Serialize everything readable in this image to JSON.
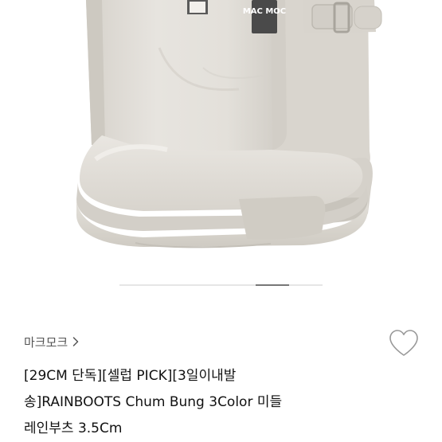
{
  "product": {
    "image": {
      "label_text": "MAC MOC",
      "background": "#ffffff",
      "boot_color": "#e2dfd9",
      "sole_color": "#ddd9d2"
    },
    "carousel": {
      "current": 4,
      "total": 6
    },
    "brand": {
      "name": "마크모크",
      "chevron_icon": "chevron-right-icon"
    },
    "wishlist": {
      "icon": "heart-outline-icon"
    },
    "title_lines": [
      "[29CM 단독][셀럽 PICK][3일이내발",
      "송]RAINBOOTS Chum Bung 3Color 미들",
      "레인부츠 3.5Cm"
    ]
  }
}
